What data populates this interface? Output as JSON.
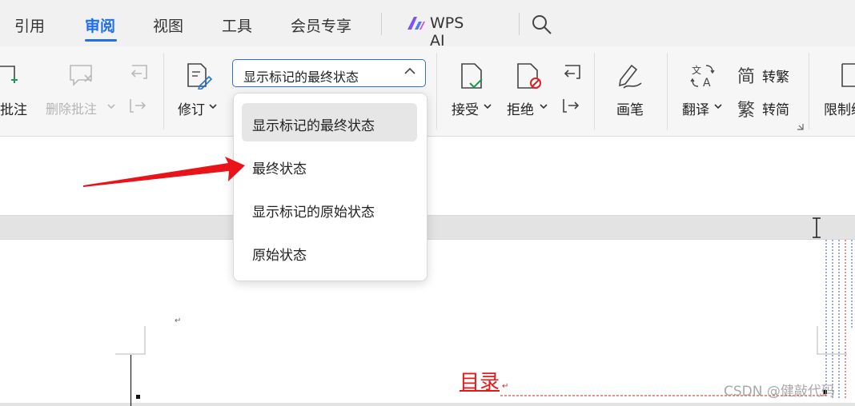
{
  "tabs": [
    {
      "label": "引用",
      "active": false
    },
    {
      "label": "审阅",
      "active": true
    },
    {
      "label": "视图",
      "active": false
    },
    {
      "label": "工具",
      "active": false
    },
    {
      "label": "会员专享",
      "active": false
    },
    {
      "label": "WPS AI",
      "active": false
    }
  ],
  "ribbon": {
    "comment_label": "批注",
    "delete_comment_label": "删除批注",
    "revise_label": "修订",
    "view_select_value": "显示标记的最终状态",
    "accept_label": "接受",
    "reject_label": "拒绝",
    "pen_label": "画笔",
    "translate_label": "翻译",
    "to_traditional_label": "转繁",
    "to_simplified_label": "转简",
    "restrict_label": "限制编"
  },
  "dropdown": {
    "options": [
      {
        "label": "显示标记的最终状态",
        "selected": true
      },
      {
        "label": "最终状态",
        "selected": false
      },
      {
        "label": "显示标记的原始状态",
        "selected": false
      },
      {
        "label": "原始状态",
        "selected": false
      }
    ]
  },
  "document": {
    "toc_heading": "目录",
    "paragraph_mark": "↵"
  },
  "watermark": "CSDN @健敲代码",
  "colors": {
    "accent": "#1f6fe8",
    "annotation_arrow": "#e8141a",
    "toc_text": "#e01b1b"
  },
  "icons": [
    "search-icon",
    "ai-logo-icon",
    "add-comment-icon",
    "delete-comment-icon",
    "prev-comment-icon",
    "next-comment-icon",
    "track-changes-icon",
    "accept-icon",
    "reject-icon",
    "prev-change-icon",
    "next-change-icon",
    "pen-icon",
    "translate-icon",
    "traditional-icon",
    "simplified-icon",
    "restrict-edit-icon",
    "text-cursor-icon",
    "chevron-up-icon"
  ]
}
